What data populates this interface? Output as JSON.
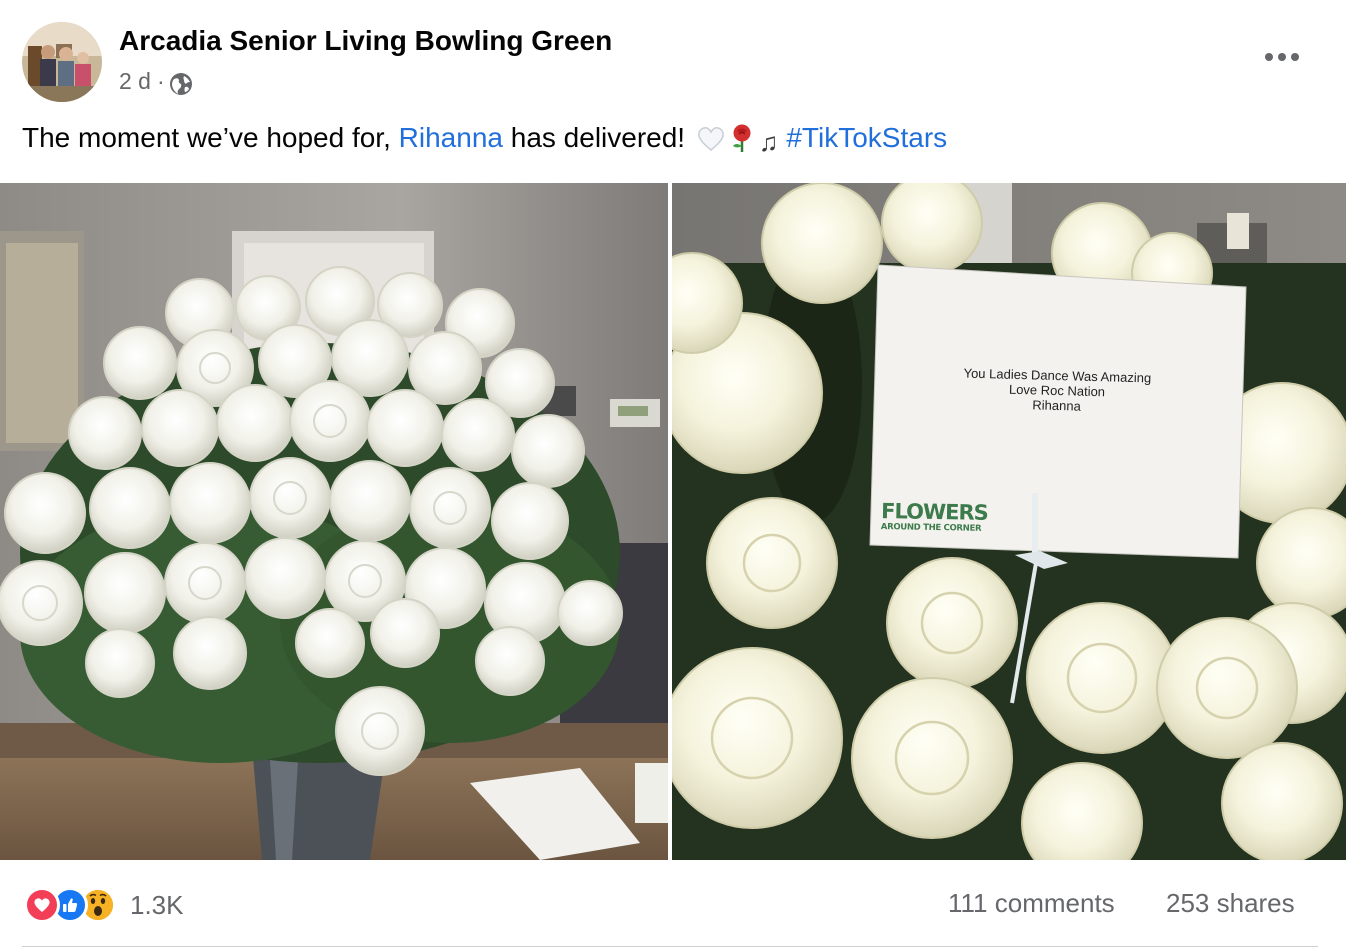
{
  "post": {
    "author": "Arcadia Senior Living Bowling Green",
    "timestamp": "2 d",
    "separator": "·",
    "privacy_icon": "globe-icon",
    "more_icon": "more-horizontal-icon",
    "text_before": "The moment we’ve hoped for, ",
    "mention": "Rihanna",
    "text_after": " has delivered!",
    "emojis": [
      "white-heart",
      "rose",
      "musical-notes"
    ],
    "hashtag": "#TikTokStars"
  },
  "photos": {
    "left_alt": "White roses in vase",
    "right_alt": "White roses with card",
    "card_lines": [
      "You Ladies Dance Was Amazing",
      "Love Roc Nation",
      "Rihanna"
    ],
    "florist_logo": "FLOWERS",
    "florist_logo_sub": "AROUND THE CORNER"
  },
  "stats": {
    "reaction_icons": [
      "love-reaction-icon",
      "like-reaction-icon",
      "wow-reaction-icon"
    ],
    "reactions_count": "1.3K",
    "comments": "111 comments",
    "shares": "253 shares"
  },
  "colors": {
    "link": "#216fdb",
    "secondary_text": "#65676b",
    "love": "#f33e58",
    "like": "#1877f2",
    "wow": "#f7b125"
  }
}
